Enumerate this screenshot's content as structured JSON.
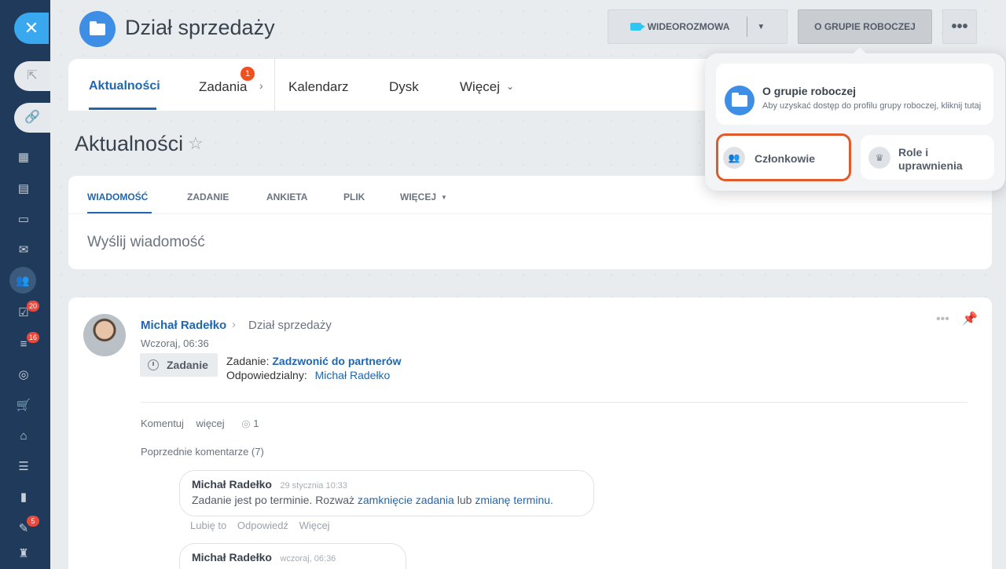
{
  "sidebar": {
    "close_glyph": "✕",
    "ext_icons": [
      "external-link-icon",
      "link-icon"
    ],
    "badges": {
      "tasks": "20",
      "filters": "16",
      "list": "5"
    }
  },
  "header": {
    "group_title": "Dział sprzedaży",
    "video_label": "WIDEOROZMOWA",
    "about_label": "O GRUPIE ROBOCZEJ",
    "more_label": "•••"
  },
  "tabs": [
    {
      "label": "Aktualności"
    },
    {
      "label": "Zadania",
      "badge": "1"
    },
    {
      "label": "Kalendarz"
    },
    {
      "label": "Dysk"
    },
    {
      "label": "Więcej"
    }
  ],
  "page_title": "Aktualności",
  "composer": {
    "tabs": [
      "WIADOMOŚĆ",
      "ZADANIE",
      "ANKIETA",
      "PLIK",
      "WIĘCEJ"
    ],
    "placeholder": "Wyślij wiadomość"
  },
  "post": {
    "author": "Michał Radełko",
    "destination": "Dział sprzedaży",
    "time": "Wczoraj, 06:36",
    "chip_label": "Zadanie",
    "task_prefix": "Zadanie:",
    "task_name": "Zadzwonić do partnerów",
    "responsible_label": "Odpowiedzialny:",
    "responsible_name": "Michał Radełko",
    "actions": {
      "comment": "Komentuj",
      "more": "więcej",
      "views": "1"
    },
    "previous_comments": "Poprzednie komentarze (7)",
    "comments": [
      {
        "author": "Michał Radełko",
        "date": "29 stycznia 10:33",
        "text_before": "Zadanie jest po terminie. Rozważ ",
        "link1": "zamknięcie zadania",
        "text_mid": " lub ",
        "link2": "zmianę terminu",
        "text_after": "."
      },
      {
        "author": "Michał Radełko",
        "date": "wczoraj, 06:36"
      }
    ],
    "comment_actions": [
      "Lubię to",
      "Odpowiedź",
      "Więcej"
    ]
  },
  "dropdown": {
    "main_title": "O grupie roboczej",
    "main_desc": "Aby uzyskać dostęp do profilu grupy roboczej, kliknij tutaj",
    "members_label": "Członkowie",
    "roles_label": "Role i uprawnienia"
  },
  "colors": {
    "accent": "#2067b0",
    "highlight": "#e05a2b",
    "sidebar": "#1f3a5a"
  }
}
